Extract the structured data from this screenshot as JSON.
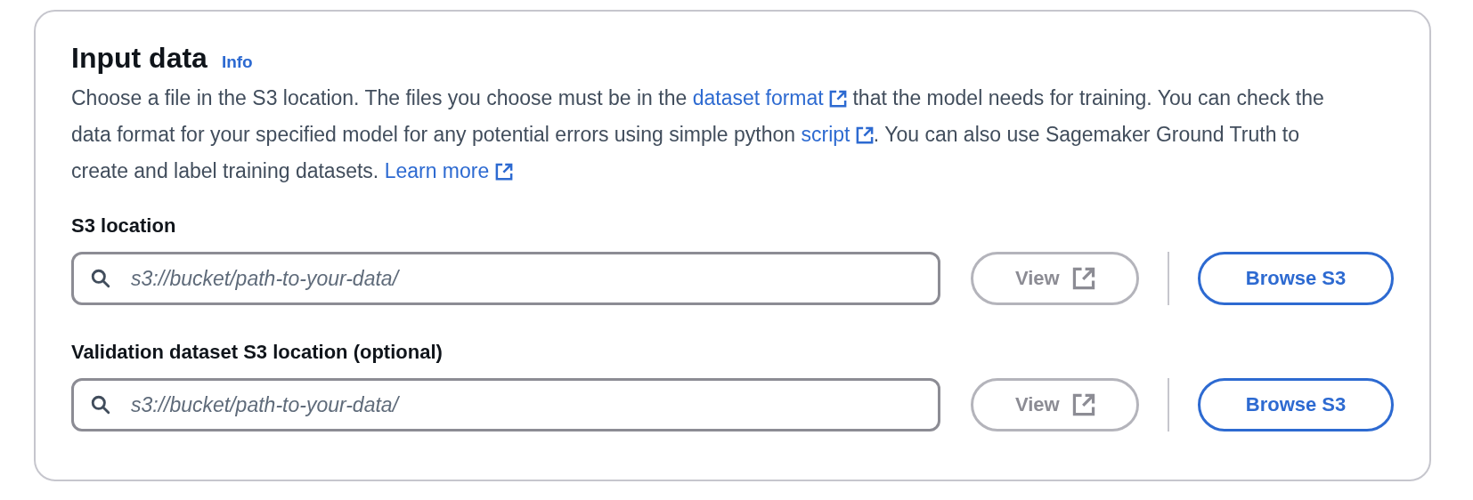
{
  "header": {
    "title": "Input data",
    "info_link": "Info"
  },
  "description": [
    {
      "kind": "text",
      "text": "Choose a file in the S3 location. The files you choose must be in the "
    },
    {
      "kind": "link",
      "text": "dataset format"
    },
    {
      "kind": "text",
      "text": " that the model needs for training. You can check the data format for your specified model for any potential errors using simple python "
    },
    {
      "kind": "link",
      "text": "script"
    },
    {
      "kind": "text",
      "text": ". You can also use Sagemaker Ground Truth to create and label training datasets. "
    },
    {
      "kind": "link",
      "text": "Learn more"
    }
  ],
  "fields": [
    {
      "label": "S3 location",
      "placeholder": "s3://bucket/path-to-your-data/",
      "view_button": {
        "label": "View",
        "disabled": true
      },
      "browse_button": {
        "label": "Browse S3"
      }
    },
    {
      "label": "Validation dataset S3 location (optional)",
      "placeholder": "s3://bucket/path-to-your-data/",
      "view_button": {
        "label": "View",
        "disabled": true
      },
      "browse_button": {
        "label": "Browse S3"
      }
    }
  ]
}
